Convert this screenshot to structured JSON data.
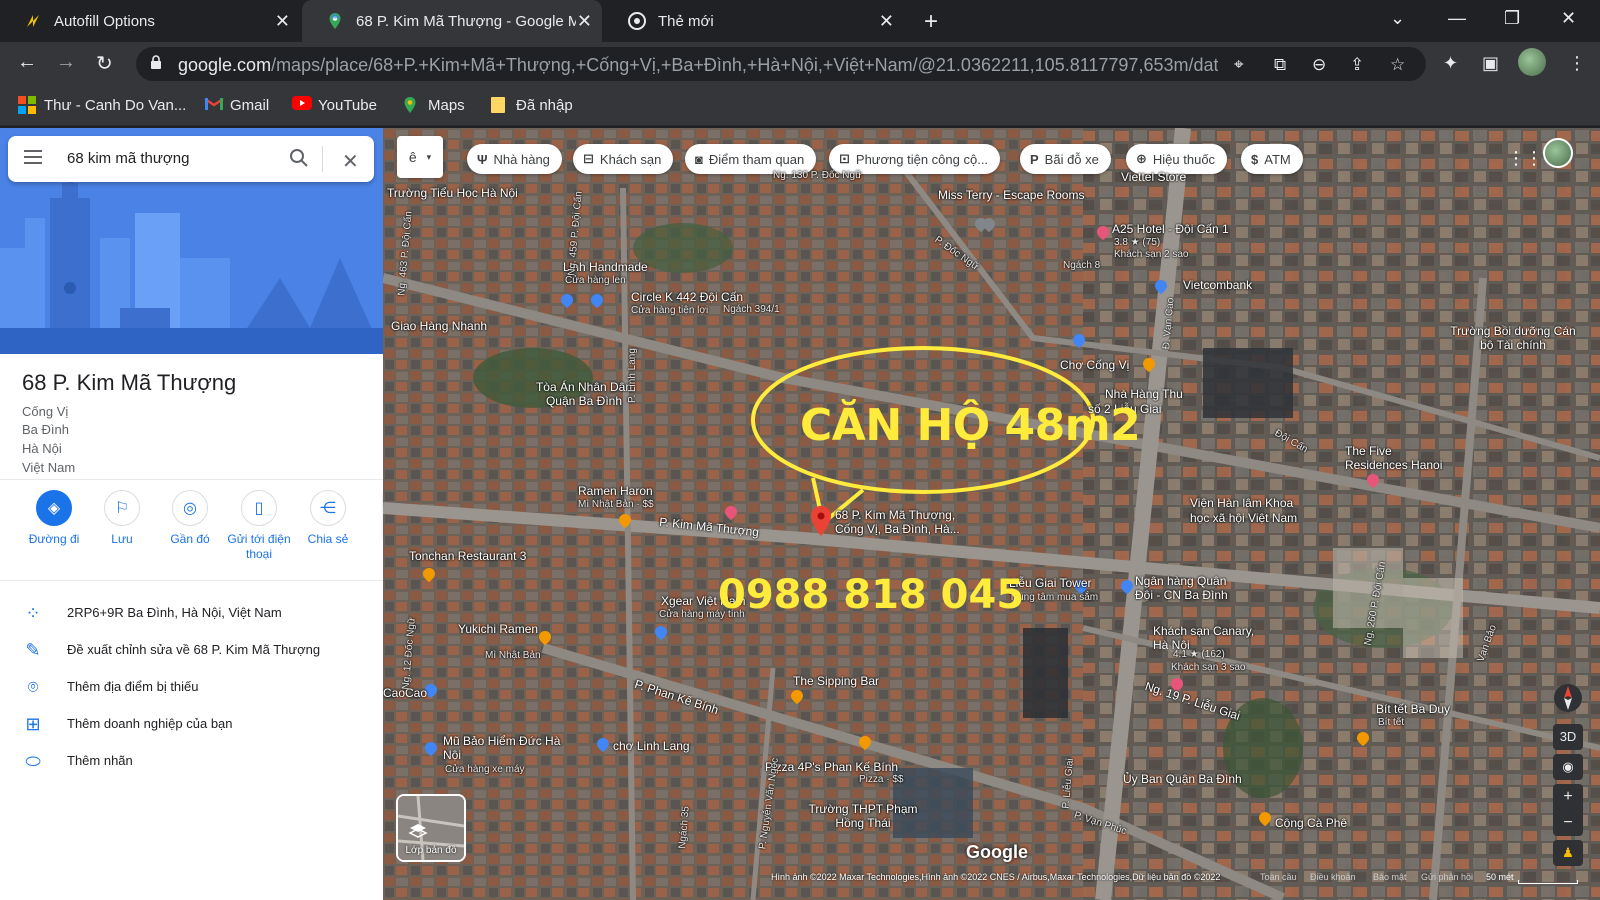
{
  "browser": {
    "tabs": [
      {
        "title": "Autofill Options",
        "active": false
      },
      {
        "title": "68 P. Kim Mã Thượng - Google M",
        "active": true
      },
      {
        "title": "Thẻ mới",
        "active": false
      }
    ],
    "url_host": "google.com",
    "url_path": "/maps/place/68+P.+Kim+Mã+Thượng,+Cống+Vị,+Ba+Đình,+Hà+Nội,+Việt+Nam/@21.0362211,105.8117797,653m/dat..."
  },
  "bookmarks": [
    {
      "label": "Thư - Canh Do Van...",
      "icon": "microsoft-icon"
    },
    {
      "label": "Gmail",
      "icon": "gmail-icon"
    },
    {
      "label": "YouTube",
      "icon": "youtube-icon"
    },
    {
      "label": "Maps",
      "icon": "maps-icon"
    },
    {
      "label": "Đã nhập",
      "icon": "folder-icon"
    }
  ],
  "sidebar": {
    "search_query": "68 kim mã thượng",
    "place_title": "68 P. Kim Mã Thượng",
    "address_lines": [
      "Cống Vị",
      "Ba Đình",
      "Hà Nội",
      "Việt Nam"
    ],
    "actions": [
      {
        "label": "Đường đi",
        "icon": "directions-icon"
      },
      {
        "label": "Lưu",
        "icon": "bookmark-icon"
      },
      {
        "label": "Gần đó",
        "icon": "nearby-icon"
      },
      {
        "label": "Gửi tới điện thoại",
        "label_l1": "Gửi tới điện",
        "label_l2": "thoại",
        "icon": "send-to-phone-icon"
      },
      {
        "label": "Chia sẻ",
        "icon": "share-icon"
      }
    ],
    "info_rows": [
      {
        "text": "2RP6+9R Ba Đình, Hà Nội, Việt Nam",
        "icon": "plus-code-icon"
      },
      {
        "text": "Đề xuất chỉnh sửa về 68 P. Kim Mã Thượng",
        "icon": "edit-icon"
      },
      {
        "text": "Thêm địa điểm bị thiếu",
        "icon": "add-place-icon"
      },
      {
        "text": "Thêm doanh nghiệp của bạn",
        "icon": "add-business-icon"
      },
      {
        "text": "Thêm nhãn",
        "icon": "label-icon"
      }
    ]
  },
  "map": {
    "language_button": "ê",
    "chips": [
      {
        "label": "Nhà hàng",
        "icon": "restaurant-icon"
      },
      {
        "label": "Khách sạn",
        "icon": "hotel-icon"
      },
      {
        "label": "Điểm tham quan",
        "icon": "camera-icon"
      },
      {
        "label": "Phương tiện công cộ...",
        "icon": "transit-icon"
      },
      {
        "label": "Bãi đỗ xe",
        "icon": "parking-icon"
      },
      {
        "label": "Hiệu thuốc",
        "icon": "pharmacy-icon"
      },
      {
        "label": "ATM",
        "icon": "atm-icon"
      }
    ],
    "labels": [
      "Ng. 130 P. Đốc Ngữ",
      "Trường Tiểu Học Hà Nội",
      "Miss Terry - Escape Rooms",
      "Viettel Store",
      "A25 Hotel - Đội Cấn 1",
      "3.8 ★ (75)",
      "Khách sạn 2 sao",
      "Ngách 8",
      "P. Đốc Ngữ",
      "Linh Handmade",
      "Cửa hàng len",
      "Circle K 442 Đội Cấn",
      "Cửa hàng tiện lợi",
      "Ngách 394/1",
      "Giao Hàng Nhanh",
      "Vietcombank",
      "Trường Bồi dưỡng Cán bộ Tài chính",
      "Chợ Cống Vị",
      "Nhà Hàng Thu",
      "số 2 Liễu Giai",
      "Tòa Án Nhân Dân Quận Ba Đình",
      "P. Linh Lang",
      "Đội Cấn",
      "The Five Residences Hanoi",
      "Ramen Haron",
      "Mì Nhật Bản · $$",
      "P. Kim Mã Thượng",
      "68 P. Kim Mã Thượng,",
      "Cống Vị, Ba Đình, Hà...",
      "Viện Hàn lâm Khoa",
      "học xã hội Việt Nam",
      "Tonchan Restaurant 3",
      "Xgear Việt Nam",
      "Cửa hàng máy tính",
      "Liễu Giai Tower",
      "Trung tâm mua sắm",
      "Ngân hàng Quân Đội - CN Ba Đình",
      "Khách sạn Canary, Hà Nội",
      "4.1 ★ (162)",
      "Khách sạn 3 sao",
      "Yukichi Ramen",
      "Mì Nhật Bản",
      "The Sipping Bar",
      "CaoCao",
      "P. Phan Kế Bính",
      "Ng. 19 P. Liễu Giai",
      "Bít tết Ba Duy",
      "Bít tết",
      "Mũ Bảo Hiểm Đức Hà Nội",
      "Cửa hàng xe máy",
      "chợ Linh Lang",
      "Pizza 4P's Phan Kế Bính",
      "Pizza · $$",
      "Ủy Ban Quận Ba Đình",
      "Trường THPT Phạm Hồng Thái",
      "P. Vạn Phúc",
      "Cộng Cà Phê",
      "P. Liễu Giai",
      "Đ. Vạn Cao",
      "Ng. 260 P. Đội Cấn",
      "Vạn Bảo",
      "Ngách 35",
      "Ng. 459 P. Đội Cấn",
      "Ng. 463 P. Đội Cấn",
      "Ng. 12 Đốc Ngữ",
      "P. Nguyễn Văn Ngọc"
    ],
    "annotation_title": "CĂN HỘ 48m2",
    "annotation_phone": "0988 818 045",
    "layers_label": "Lớp bản đồ",
    "google_watermark": "Google",
    "attribution": "Hình ảnh ©2022 Maxar Technologies,Hình ảnh ©2022 CNES / Airbus,Maxar Technologies,Dữ liệu bản đồ ©2022",
    "footer_links": [
      "Toàn cầu",
      "Điều khoản",
      "Bảo mật",
      "Gửi phản hồi",
      "50 mét"
    ],
    "controls": {
      "threed": "3D",
      "zoom_in": "+",
      "zoom_out": "−"
    }
  },
  "colors": {
    "accent": "#1a73e8",
    "annotation": "#ffeb3b",
    "pin": "#ea4335"
  }
}
